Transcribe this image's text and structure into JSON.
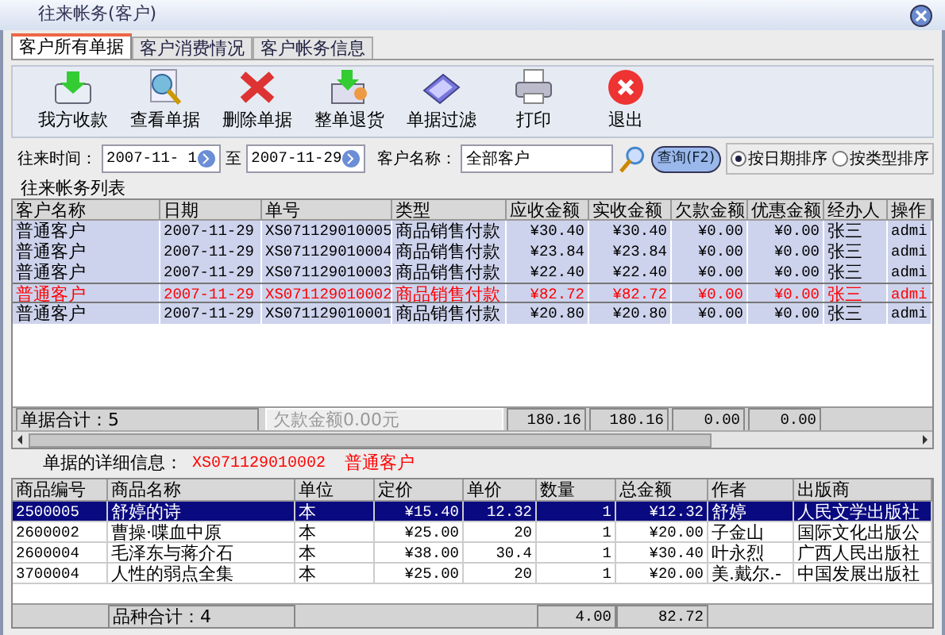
{
  "window": {
    "title": "往来帐务(客户)"
  },
  "tabs": [
    {
      "label": "客户所有单据",
      "selected": true
    },
    {
      "label": "客户消费情况",
      "selected": false
    },
    {
      "label": "客户帐务信息",
      "selected": false
    }
  ],
  "toolbar": [
    "我方收款",
    "查看单据",
    "删除单据",
    "整单退货",
    "单据过滤",
    "打印",
    "退出"
  ],
  "filter": {
    "time_label": "往来时间：",
    "from": "2007-11- 1",
    "to_label": "至",
    "to": "2007-11-29",
    "customer_label": "客户名称：",
    "customer": "全部客户",
    "query_button": "查询(F2)",
    "sort_options": [
      {
        "label": "按日期排序",
        "selected": true
      },
      {
        "label": "按类型排序",
        "selected": false
      }
    ]
  },
  "list": {
    "title": "往来帐务列表",
    "columns": [
      "客户名称",
      "日期",
      "单号",
      "类型",
      "应收金额",
      "实收金额",
      "欠款金额",
      "优惠金额",
      "经办人",
      "操作"
    ],
    "rows": [
      {
        "cells": [
          "普通客户",
          "2007-11-29",
          "XS071129010005",
          "商品销售付款",
          "¥30.40",
          "¥30.40",
          "¥0.00",
          "¥0.00",
          "张三",
          "admi"
        ],
        "selected": false
      },
      {
        "cells": [
          "普通客户",
          "2007-11-29",
          "XS071129010004",
          "商品销售付款",
          "¥23.84",
          "¥23.84",
          "¥0.00",
          "¥0.00",
          "张三",
          "admi"
        ],
        "selected": false
      },
      {
        "cells": [
          "普通客户",
          "2007-11-29",
          "XS071129010003",
          "商品销售付款",
          "¥22.40",
          "¥22.40",
          "¥0.00",
          "¥0.00",
          "张三",
          "admi"
        ],
        "selected": false
      },
      {
        "cells": [
          "普通客户",
          "2007-11-29",
          "XS071129010002",
          "商品销售付款",
          "¥82.72",
          "¥82.72",
          "¥0.00",
          "¥0.00",
          "张三",
          "admi"
        ],
        "selected": true
      },
      {
        "cells": [
          "普通客户",
          "2007-11-29",
          "XS071129010001",
          "商品销售付款",
          "¥20.80",
          "¥20.80",
          "¥0.00",
          "¥0.00",
          "张三",
          "admi"
        ],
        "selected": false
      }
    ],
    "count": "单据合计：5",
    "debt": "欠款金额0.00元",
    "totals": [
      "180.16",
      "180.16",
      "0.00",
      "0.00"
    ]
  },
  "detail": {
    "label": "单据的详细信息：",
    "number": "XS071129010002",
    "customer": "普通客户",
    "columns": [
      "商品编号",
      "商品名称",
      "单位",
      "定价",
      "单价",
      "数量",
      "总金额",
      "作者",
      "出版商"
    ],
    "rows": [
      {
        "cells": [
          "2500005",
          "舒婷的诗",
          "本",
          "¥15.40",
          "12.32",
          "1",
          "¥12.32",
          "舒婷",
          "人民文学出版社"
        ],
        "selected": true
      },
      {
        "cells": [
          "2600002",
          "曹操·喋血中原",
          "本",
          "¥25.00",
          "20",
          "1",
          "¥20.00",
          "子金山",
          "国际文化出版公"
        ],
        "selected": false
      },
      {
        "cells": [
          "2600004",
          "毛泽东与蒋介石",
          "本",
          "¥38.00",
          "30.4",
          "1",
          "¥30.40",
          "叶永烈",
          "广西人民出版社"
        ],
        "selected": false
      },
      {
        "cells": [
          "3700004",
          "人性的弱点全集",
          "本",
          "¥25.00",
          "20",
          "1",
          "¥20.00",
          "美.戴尔.-",
          "中国发展出版社"
        ],
        "selected": false
      }
    ],
    "count": "品种合计：4",
    "totals": [
      "4.00",
      "82.72"
    ]
  }
}
